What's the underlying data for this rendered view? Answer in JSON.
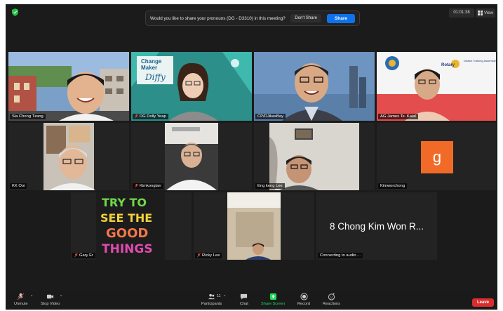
{
  "top": {
    "pronoun_prompt": "Would you like to share your pronouns (DG - D3310) in this meeting?",
    "dont_share": "Don't Share",
    "share": "Share",
    "timer": "01:01:38",
    "view": "View"
  },
  "tiles": [
    {
      "name": "Sia Chong Tzang",
      "muted": false
    },
    {
      "name": "DG Dolly Yeap",
      "muted": true
    },
    {
      "name": "CP/DJikasBay",
      "muted": false
    },
    {
      "name": "AG James Te. Kalal",
      "muted": false
    },
    {
      "name": "KK Ooi",
      "muted": false
    },
    {
      "name": "Kimkongtan",
      "muted": true
    },
    {
      "name": "Eng keng Lee",
      "muted": false
    },
    {
      "name": "Kimworchong",
      "muted": false
    },
    {
      "name": "Gary Er",
      "muted": true
    },
    {
      "name": "Ricky Lee",
      "muted": true
    },
    {
      "name": "Connecting to audio ...",
      "muted": false
    }
  ],
  "avatar_letter": "g",
  "big_name": "8 Chong Kim Won R...",
  "poster": {
    "lines": [
      "TRY TO",
      "SEE THE",
      "GOOD",
      "THINGS"
    ]
  },
  "slide": {
    "line1": "Change",
    "line2": "Maker",
    "handwriting": "Diffy"
  },
  "rotary": {
    "title": "Rotary",
    "subtitle": "District Training Assembly"
  },
  "toolbar": {
    "unmute": "Unmute",
    "stop_video": "Stop Video",
    "participants": "Participants",
    "participants_count": "11",
    "chat": "Chat",
    "share_screen": "Share Screen",
    "record": "Record",
    "reactions": "Reactions",
    "leave": "Leave"
  },
  "colors": {
    "share_blue": "#0e72ed",
    "leave_red": "#d92d2d",
    "share_screen_green": "#23d959",
    "avatar_orange": "#f26a27"
  }
}
